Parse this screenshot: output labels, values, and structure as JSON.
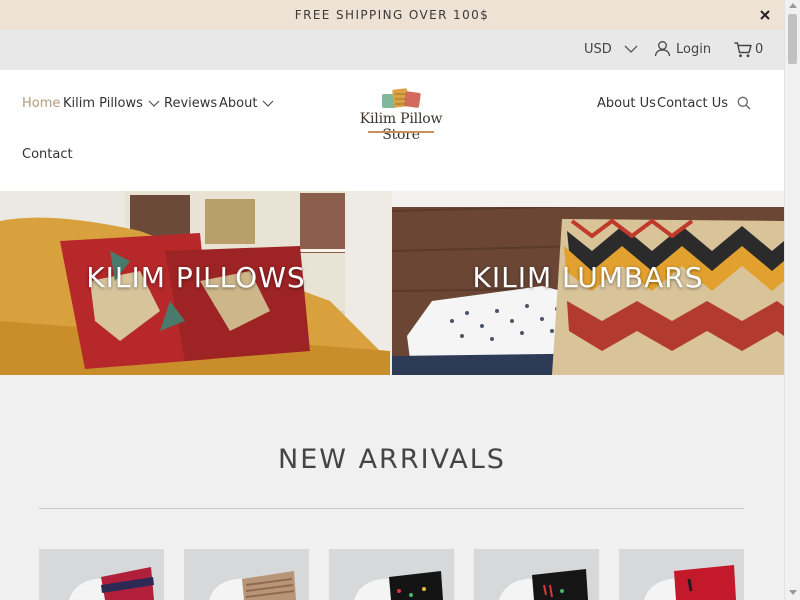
{
  "announcement": {
    "text": "FREE SHIPPING OVER 100$"
  },
  "utility": {
    "currency": "USD",
    "login_label": "Login",
    "cart_count": "0"
  },
  "logo": {
    "text": "Kilim Pillow Store"
  },
  "nav_left": [
    {
      "label": "Home",
      "active": true,
      "dropdown": false
    },
    {
      "label": "Kilim Pillows",
      "active": false,
      "dropdown": true
    },
    {
      "label": "Reviews",
      "active": false,
      "dropdown": false
    },
    {
      "label": "About",
      "active": false,
      "dropdown": true
    },
    {
      "label": "Contact",
      "active": false,
      "dropdown": false
    }
  ],
  "nav_right": [
    {
      "label": "About Us"
    },
    {
      "label": "Contact Us"
    }
  ],
  "banners": [
    {
      "title": "KILIM PILLOWS"
    },
    {
      "title": "KILIM LUMBARS"
    }
  ],
  "section": {
    "title": "NEW ARRIVALS"
  },
  "colors": {
    "announcement_bg": "#ede2d3",
    "utility_bg": "#e8e8e8",
    "active_nav": "#b49a7c",
    "page_bg": "#f0f0f0"
  },
  "icons": {
    "close": "close-icon",
    "currency_chevron": "chevron-down-icon",
    "login": "user-icon",
    "cart": "cart-icon",
    "search": "search-icon"
  }
}
